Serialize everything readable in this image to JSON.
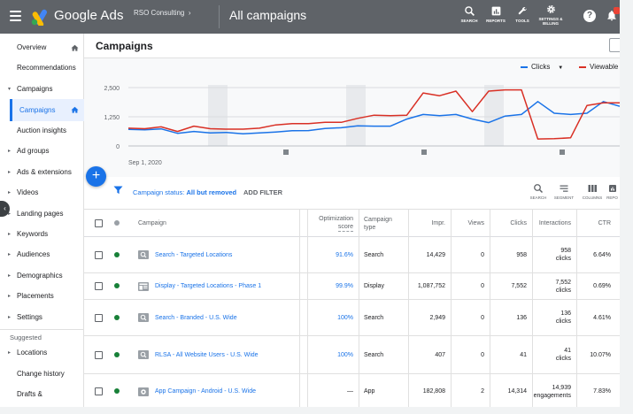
{
  "topbar": {
    "brand": "Google Ads",
    "account": "RSO Consulting",
    "account_chevron": "›",
    "page_title": "All campaigns",
    "tools": [
      {
        "label": "SEARCH",
        "icon": "search-icon"
      },
      {
        "label": "REPORTS",
        "icon": "reports-icon"
      },
      {
        "label": "TOOLS",
        "icon": "wrench-icon"
      },
      {
        "label": "SETTINGS & BILLING",
        "label_line1": "SETTINGS &",
        "label_line2": "BILLING",
        "icon": "gear-icon"
      }
    ],
    "help": "?"
  },
  "sidebar": {
    "items": [
      {
        "label": "Overview",
        "home": true
      },
      {
        "label": "Recommendations"
      },
      {
        "label": "Campaigns",
        "caret": "▾"
      },
      {
        "label": "Campaigns",
        "active": true,
        "home": true
      },
      {
        "label": "Auction insights"
      },
      {
        "label": "Ad groups",
        "caret": "▸"
      },
      {
        "label": "Ads & extensions",
        "caret": "▸"
      },
      {
        "label": "Videos",
        "caret": "▸"
      },
      {
        "label": "Landing pages",
        "caret": "▸"
      },
      {
        "label": "Keywords",
        "caret": "▸"
      },
      {
        "label": "Audiences",
        "caret": "▸"
      },
      {
        "label": "Demographics",
        "caret": "▸"
      },
      {
        "label": "Placements",
        "caret": "▸"
      },
      {
        "label": "Settings",
        "caret": "▸"
      }
    ],
    "suggested_header": "Suggested",
    "suggested": [
      {
        "label": "Locations",
        "caret": "▸"
      },
      {
        "label": "Change history"
      },
      {
        "label": "Drafts &"
      }
    ],
    "collapse_glyph": "‹"
  },
  "main": {
    "title": "Campaigns",
    "filter": {
      "prefix": "Campaign status: ",
      "value": "All but removed",
      "add_filter": "ADD FILTER"
    },
    "fab": "+",
    "toolbar": [
      {
        "label": "SEARCH",
        "icon": "search-icon"
      },
      {
        "label": "SEGMENT",
        "icon": "segment-icon"
      },
      {
        "label": "COLUMNS",
        "icon": "columns-icon"
      },
      {
        "label": "REPO",
        "icon": "reports-icon"
      }
    ]
  },
  "colors": {
    "clicks": "#1a73e8",
    "viewable": "#d93025",
    "accent": "#1a73e8",
    "enabled": "#188038",
    "topbar": "#5f6368"
  },
  "chart_data": {
    "type": "line",
    "series": [
      {
        "name": "Clicks",
        "values": [
          710,
          690,
          730,
          540,
          620,
          560,
          580,
          520,
          560,
          600,
          650,
          660,
          750,
          780,
          860,
          850,
          850,
          1150,
          1350,
          1300,
          1350,
          1150,
          1000,
          1280,
          1350,
          1900,
          1400,
          1350,
          1400,
          1900,
          1700
        ]
      },
      {
        "name": "Viewable",
        "values": [
          760,
          740,
          820,
          620,
          850,
          740,
          720,
          720,
          760,
          900,
          960,
          960,
          1010,
          1010,
          1180,
          1320,
          1300,
          1320,
          2270,
          2150,
          2350,
          1470,
          2350,
          2400,
          2400,
          300,
          310,
          350,
          1730,
          1850,
          1850
        ]
      }
    ],
    "yticks": [
      "2,500",
      "1,250",
      "0"
    ],
    "ylim": [
      0,
      2500
    ],
    "x_start_label": "Sep 1, 2020",
    "legend": [
      "Clicks",
      "Viewable"
    ],
    "legend_position": "top-right",
    "grid": true
  },
  "table": {
    "headers": {
      "campaign": "Campaign",
      "opt1": "Optimization",
      "opt2": "score",
      "type1": "Campaign",
      "type2": "type",
      "impr": "Impr.",
      "views": "Views",
      "clicks": "Clicks",
      "interactions": "Interactions",
      "ctr": "CTR"
    },
    "rows": [
      {
        "name": "Search - Targeted Locations",
        "icon": "search-campaign-icon",
        "opt": "91.6%",
        "type": "Search",
        "impr": "14,429",
        "views": "0",
        "clicks": "958",
        "int1": "958",
        "int2": "clicks",
        "ctr": "6.64%"
      },
      {
        "name": "Display - Targeted Locations - Phase 1",
        "icon": "display-campaign-icon",
        "opt": "99.9%",
        "type": "Display",
        "impr": "1,087,752",
        "views": "0",
        "clicks": "7,552",
        "int1": "7,552",
        "int2": "clicks",
        "ctr": "0.69%"
      },
      {
        "name": "Search - Branded - U.S. Wide",
        "icon": "search-campaign-icon",
        "opt": "100%",
        "type": "Search",
        "impr": "2,949",
        "views": "0",
        "clicks": "136",
        "int1": "136",
        "int2": "clicks",
        "ctr": "4.61%"
      },
      {
        "name": "RLSA - All Website Users - U.S. Wide",
        "icon": "search-campaign-icon",
        "opt": "100%",
        "type": "Search",
        "impr": "407",
        "views": "0",
        "clicks": "41",
        "int1": "41",
        "int2": "clicks",
        "ctr": "10.07%"
      },
      {
        "name": "App Campaign - Android - U.S. Wide",
        "icon": "app-campaign-icon",
        "opt": "—",
        "type": "App",
        "impr": "182,808",
        "views": "2",
        "clicks": "14,314",
        "int1": "14,939",
        "int2": "engagements",
        "ctr": "7.83%"
      }
    ]
  }
}
